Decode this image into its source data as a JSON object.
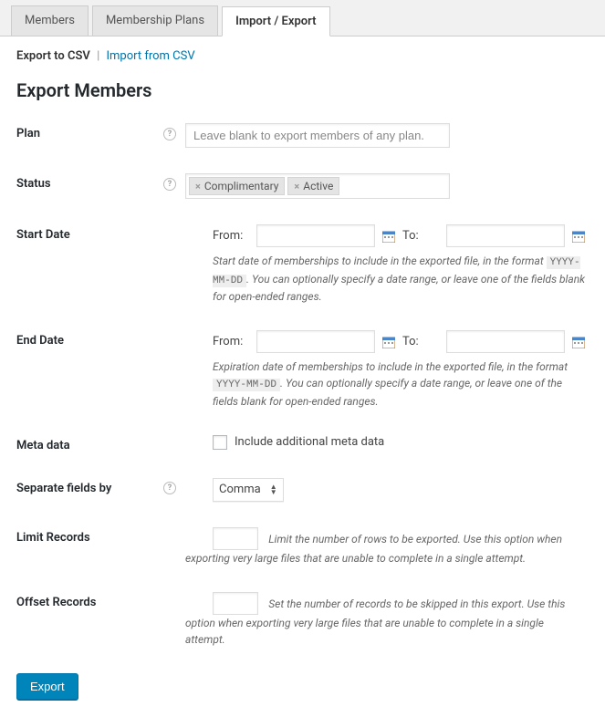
{
  "tabs": {
    "members": "Members",
    "plans": "Membership Plans",
    "import_export": "Import / Export"
  },
  "subnav": {
    "export": "Export to CSV",
    "import": "Import from CSV"
  },
  "heading": "Export Members",
  "fields": {
    "plan": {
      "label": "Plan",
      "placeholder": "Leave blank to export members of any plan."
    },
    "status": {
      "label": "Status",
      "tags": [
        "Complimentary",
        "Active"
      ]
    },
    "start_date": {
      "label": "Start Date",
      "from": "From:",
      "to": "To:",
      "help": "Start date of memberships to include in the exported file, in the format ",
      "code": "YYYY-MM-DD",
      "help2": ". You can optionally specify a date range, or leave one of the fields blank for open-ended ranges."
    },
    "end_date": {
      "label": "End Date",
      "from": "From:",
      "to": "To:",
      "help": "Expiration date of memberships to include in the exported file, in the format ",
      "code": "YYYY-MM-DD",
      "help2": ". You can optionally specify a date range, or leave one of the fields blank for open-ended ranges."
    },
    "meta": {
      "label": "Meta data",
      "checkbox": "Include additional meta data"
    },
    "separator": {
      "label": "Separate fields by",
      "value": "Comma"
    },
    "limit": {
      "label": "Limit Records",
      "help": "Limit the number of rows to be exported. Use this option when exporting very large files that are unable to complete in a single attempt."
    },
    "offset": {
      "label": "Offset Records",
      "help": "Set the number of records to be skipped in this export. Use this option when exporting very large files that are unable to complete in a single attempt."
    }
  },
  "buttons": {
    "export": "Export"
  }
}
